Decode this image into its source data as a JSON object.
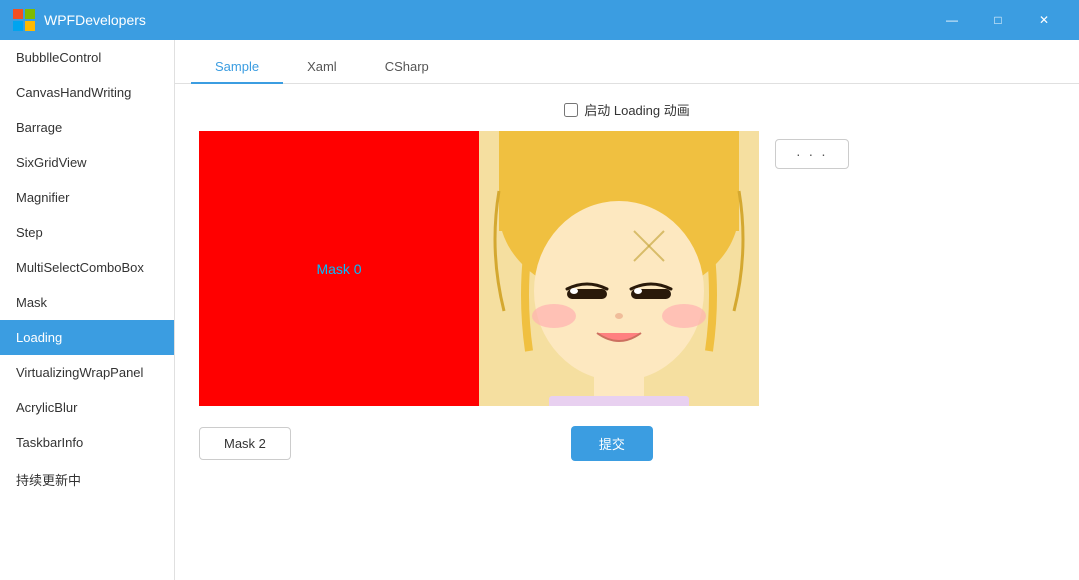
{
  "titlebar": {
    "logo_label": "WPF",
    "title": "WPFDevelopers",
    "min_label": "—",
    "max_label": "□",
    "close_label": "✕"
  },
  "sidebar": {
    "items": [
      {
        "label": "BubblleControl",
        "active": false
      },
      {
        "label": "CanvasHandWriting",
        "active": false
      },
      {
        "label": "Barrage",
        "active": false
      },
      {
        "label": "SixGridView",
        "active": false
      },
      {
        "label": "Magnifier",
        "active": false
      },
      {
        "label": "Step",
        "active": false
      },
      {
        "label": "MultiSelectComboBox",
        "active": false
      },
      {
        "label": "Mask",
        "active": false
      },
      {
        "label": "Loading",
        "active": true
      },
      {
        "label": "VirtualizingWrapPanel",
        "active": false
      },
      {
        "label": "AcrylicBlur",
        "active": false
      },
      {
        "label": "TaskbarInfo",
        "active": false
      },
      {
        "label": "持续更新中",
        "active": false
      }
    ]
  },
  "tabs": [
    {
      "label": "Sample",
      "active": true
    },
    {
      "label": "Xaml",
      "active": false
    },
    {
      "label": "CSharp",
      "active": false
    }
  ],
  "sample": {
    "checkbox_label": "启动 Loading 动画",
    "mask0_label": "Mask 0",
    "mask2_label": "Mask 2",
    "submit_label": "提交",
    "dots_label": "· · ·"
  }
}
